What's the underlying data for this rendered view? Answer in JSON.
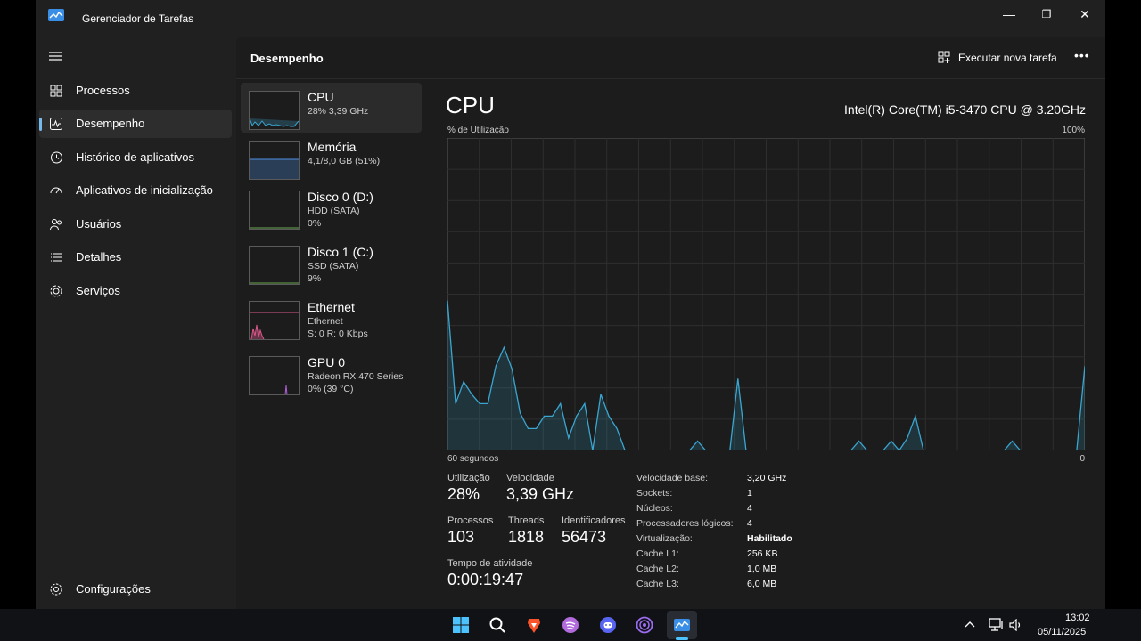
{
  "window": {
    "title": "Gerenciador de Tarefas",
    "minimize_glyph": "—",
    "maximize_glyph": "❐",
    "close_glyph": "✕"
  },
  "sidebar": {
    "items": [
      {
        "label": "Processos",
        "icon": "processes-icon"
      },
      {
        "label": "Desempenho",
        "icon": "performance-icon",
        "active": true
      },
      {
        "label": "Histórico de aplicativos",
        "icon": "history-icon"
      },
      {
        "label": "Aplicativos de inicialização",
        "icon": "startup-icon"
      },
      {
        "label": "Usuários",
        "icon": "users-icon"
      },
      {
        "label": "Detalhes",
        "icon": "details-icon"
      },
      {
        "label": "Serviços",
        "icon": "services-icon"
      }
    ],
    "settings_label": "Configurações"
  },
  "header": {
    "title": "Desempenho",
    "run_task_label": "Executar nova tarefa",
    "more_label": "•••"
  },
  "devices": [
    {
      "name": "CPU",
      "sub1": "28%  3,39 GHz",
      "sub2": "",
      "color": "#3aa6d0"
    },
    {
      "name": "Memória",
      "sub1": "4,1/8,0 GB (51%)",
      "sub2": "",
      "color": "#4f8fe0"
    },
    {
      "name": "Disco 0 (D:)",
      "sub1": "HDD (SATA)",
      "sub2": "0%",
      "color": "#6aa84f"
    },
    {
      "name": "Disco 1 (C:)",
      "sub1": "SSD (SATA)",
      "sub2": "9%",
      "color": "#6aa84f"
    },
    {
      "name": "Ethernet",
      "sub1": "Ethernet",
      "sub2": "S: 0 R: 0 Kbps",
      "color": "#d9578a"
    },
    {
      "name": "GPU 0",
      "sub1": "Radeon RX 470 Series",
      "sub2": "0%  (39 °C)",
      "color": "#b15fd8"
    }
  ],
  "detail": {
    "title": "CPU",
    "model": "Intel(R) Core(TM) i5-3470 CPU @ 3.20GHz",
    "y_label": "% de Utilização",
    "y_max_label": "100%",
    "x_left_label": "60 segundos",
    "x_right_label": "0",
    "stats": {
      "utilizacao_label": "Utilização",
      "utilizacao": "28%",
      "velocidade_label": "Velocidade",
      "velocidade": "3,39 GHz",
      "processos_label": "Processos",
      "processos": "103",
      "threads_label": "Threads",
      "threads": "1818",
      "identificadores_label": "Identificadores",
      "identificadores": "56473",
      "tempo_label": "Tempo de atividade",
      "tempo": "0:00:19:47"
    },
    "props": [
      {
        "k": "Velocidade base:",
        "v": "3,20 GHz"
      },
      {
        "k": "Sockets:",
        "v": "1"
      },
      {
        "k": "Núcleos:",
        "v": "4"
      },
      {
        "k": "Processadores lógicos:",
        "v": "4"
      },
      {
        "k": "Virtualização:",
        "v": "Habilitado",
        "bold": true
      },
      {
        "k": "Cache L1:",
        "v": "256 KB"
      },
      {
        "k": "Cache L2:",
        "v": "1,0 MB"
      },
      {
        "k": "Cache L3:",
        "v": "6,0 MB"
      }
    ]
  },
  "chart_data": {
    "type": "area",
    "ylim": [
      0,
      100
    ],
    "xlim": [
      60,
      0
    ],
    "grid": true,
    "color": "#3aa6d0",
    "values": [
      48,
      15,
      22,
      18,
      15,
      15,
      27,
      33,
      26,
      12,
      7,
      7,
      11,
      11,
      15,
      4,
      11,
      15,
      0,
      18,
      11,
      7,
      0,
      0,
      0,
      0,
      0,
      0,
      0,
      0,
      0,
      3,
      0,
      0,
      0,
      0,
      23,
      0,
      0,
      0,
      0,
      0,
      0,
      0,
      0,
      0,
      0,
      0,
      0,
      0,
      0,
      3,
      0,
      0,
      0,
      3,
      0,
      4,
      11,
      0,
      0,
      0,
      0,
      0,
      0,
      0,
      0,
      0,
      0,
      0,
      3,
      0,
      0,
      0,
      0,
      0,
      0,
      0,
      0,
      27
    ]
  },
  "taskbar": {
    "icons": [
      "windows-start-icon",
      "search-icon",
      "brave-icon",
      "spotify-icon",
      "discord-icon",
      "tor-icon",
      "task-manager-icon"
    ],
    "time": "13:02",
    "date": "05/11/2025"
  }
}
